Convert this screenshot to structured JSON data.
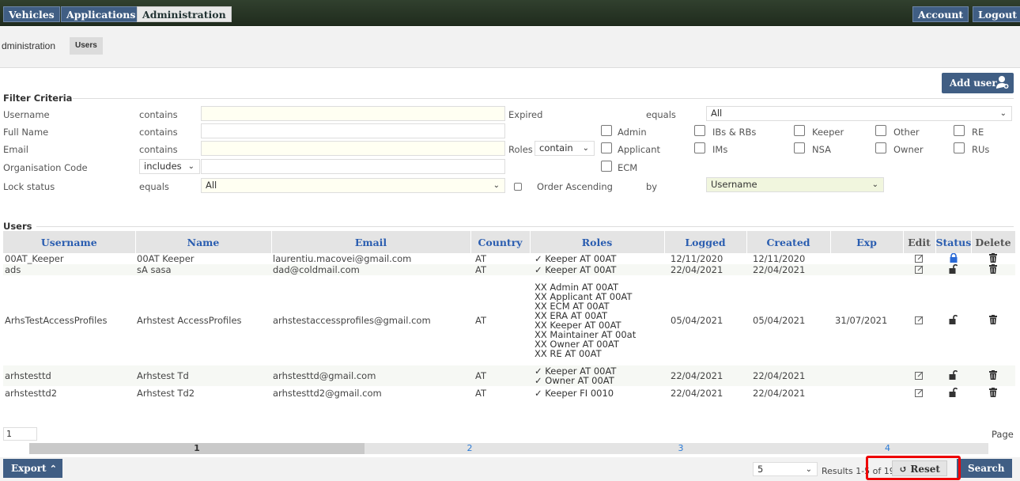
{
  "topnav": {
    "vehicles": "Vehicles",
    "applications": "Applications",
    "administration": "Administration",
    "account": "Account",
    "logout": "Logout"
  },
  "breadcrumb": {
    "parent": "dministration",
    "current": "Users"
  },
  "add_user_label": "Add user",
  "filter": {
    "title": "Filter Criteria",
    "username_label": "Username",
    "username_op": "contains",
    "fullname_label": "Full Name",
    "fullname_op": "contains",
    "email_label": "Email",
    "email_op": "contains",
    "orgcode_label": "Organisation Code",
    "orgcode_op": "includes",
    "lock_label": "Lock status",
    "lock_op": "equals",
    "lock_value": "All",
    "expired_label": "Expired",
    "expired_op": "equals",
    "expired_value": "All",
    "roles_label": "Roles",
    "roles_op": "contain",
    "roles_col1": [
      "Admin",
      "Applicant",
      "ECM"
    ],
    "roles_col2": [
      "IBs & RBs",
      "IMs"
    ],
    "roles_col3": [
      "Keeper",
      "NSA"
    ],
    "roles_col4": [
      "Other",
      "Owner"
    ],
    "roles_col5": [
      "RE",
      "RUs"
    ],
    "order_label": "Order Ascending",
    "order_by": "by",
    "order_value": "Username"
  },
  "users": {
    "title": "Users",
    "columns": [
      "Username",
      "Name",
      "Email",
      "Country",
      "Roles",
      "Logged",
      "Created",
      "Exp",
      "Edit",
      "Status",
      "Delete"
    ],
    "rows": [
      {
        "username": "00AT_Keeper",
        "name": "00AT Keeper",
        "email": "laurentiu.macovei@gmail.com",
        "country": "AT",
        "roles": [
          "✓ Keeper AT 00AT"
        ],
        "logged": "12/11/2020",
        "created": "12/11/2020",
        "exp": ""
      },
      {
        "username": "ads",
        "name": "sA sasa",
        "email": "dad@coldmail.com",
        "country": "AT",
        "roles": [
          "✓ Keeper AT 00AT"
        ],
        "logged": "22/04/2021",
        "created": "22/04/2021",
        "exp": ""
      },
      {
        "username": "ArhsTestAccessProfiles",
        "name": "Arhstest AccessProfiles",
        "email": "arhstestaccessprofiles@gmail.com",
        "country": "AT",
        "roles": [
          "XX Admin AT 00AT",
          "XX Applicant AT 00AT",
          "XX ECM AT 00AT",
          "XX ERA AT 00AT",
          "XX Keeper AT 00AT",
          "XX Maintainer AT 00at",
          "XX Owner AT 00AT",
          "XX RE AT 00AT"
        ],
        "logged": "05/04/2021",
        "created": "05/04/2021",
        "exp": "31/07/2021"
      },
      {
        "username": "arhstesttd",
        "name": "Arhstest Td",
        "email": "arhstesttd@gmail.com",
        "country": "AT",
        "roles": [
          "✓ Keeper AT 00AT",
          "✓ Owner AT 00AT"
        ],
        "logged": "22/04/2021",
        "created": "22/04/2021",
        "exp": ""
      },
      {
        "username": "arhstesttd2",
        "name": "Arhstest Td2",
        "email": "arhstesttd2@gmail.com",
        "country": "AT",
        "roles": [
          "✓ Keeper FI 0010"
        ],
        "logged": "22/04/2021",
        "created": "22/04/2021",
        "exp": ""
      }
    ]
  },
  "pagination": {
    "current_input": "1",
    "page_label": "Page",
    "pages": [
      "1",
      "2",
      "3",
      "4"
    ]
  },
  "footer": {
    "export": "Export",
    "page_size": "5",
    "results": "Results 1-5 of 19",
    "reset": "Reset",
    "search": "Search"
  }
}
